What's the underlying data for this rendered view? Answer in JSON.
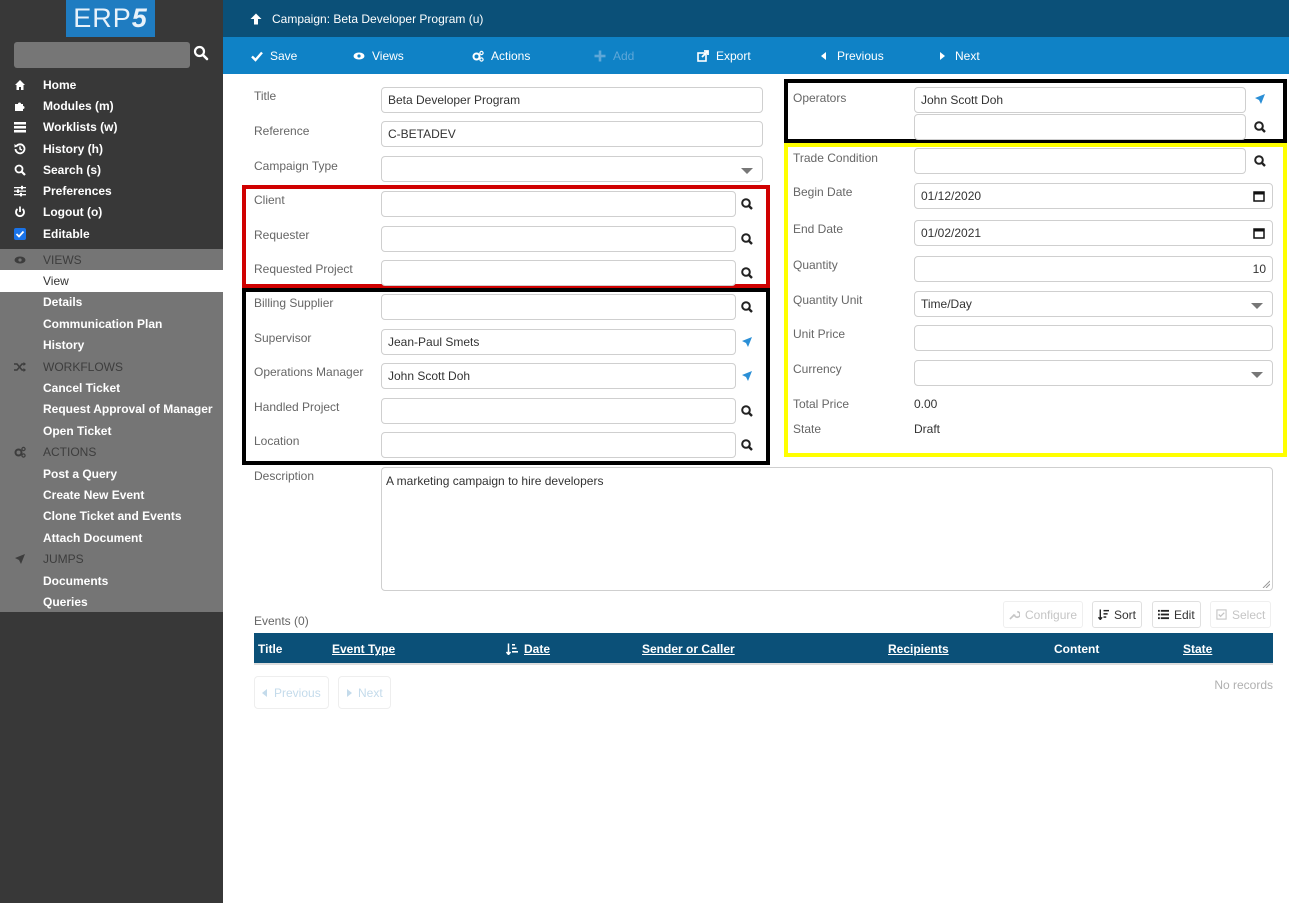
{
  "app": {
    "logo": "ERP",
    "logo_suffix": "5"
  },
  "sidebar": {
    "search_placeholder": "",
    "nav": [
      {
        "label": "Home",
        "icon": "home-icon"
      },
      {
        "label": "Modules (m)",
        "icon": "puzzle-icon"
      },
      {
        "label": "Worklists (w)",
        "icon": "tasks-icon"
      },
      {
        "label": "History (h)",
        "icon": "history-icon"
      },
      {
        "label": "Search (s)",
        "icon": "search-icon"
      },
      {
        "label": "Preferences",
        "icon": "sliders-icon"
      },
      {
        "label": "Logout (o)",
        "icon": "power-icon"
      },
      {
        "label": "Editable",
        "icon": "checkbox-icon"
      }
    ],
    "views_header": "VIEWS",
    "views": [
      "View",
      "Details",
      "Communication Plan",
      "History"
    ],
    "workflows_header": "WORKFLOWS",
    "workflows": [
      "Cancel Ticket",
      "Request Approval of Manager",
      "Open Ticket"
    ],
    "actions_header": "ACTIONS",
    "actions": [
      "Post a Query",
      "Create New Event",
      "Clone Ticket and Events",
      "Attach Document"
    ],
    "jumps_header": "JUMPS",
    "jumps": [
      "Documents",
      "Queries"
    ]
  },
  "header": {
    "title": "Campaign: Beta Developer Program (u)"
  },
  "toolbar": {
    "save": "Save",
    "views": "Views",
    "actions": "Actions",
    "add": "Add",
    "export": "Export",
    "previous": "Previous",
    "next": "Next"
  },
  "form": {
    "title": {
      "label": "Title",
      "value": "Beta Developer Program"
    },
    "reference": {
      "label": "Reference",
      "value": "C-BETADEV"
    },
    "campaign_type": {
      "label": "Campaign Type",
      "value": ""
    },
    "client": {
      "label": "Client",
      "value": ""
    },
    "requester": {
      "label": "Requester",
      "value": ""
    },
    "requested_project": {
      "label": "Requested Project",
      "value": ""
    },
    "billing_supplier": {
      "label": "Billing Supplier",
      "value": ""
    },
    "supervisor": {
      "label": "Supervisor",
      "value": "Jean-Paul Smets"
    },
    "operations_manager": {
      "label": "Operations Manager",
      "value": "John Scott Doh"
    },
    "handled_project": {
      "label": "Handled Project",
      "value": ""
    },
    "location": {
      "label": "Location",
      "value": ""
    },
    "operators": {
      "label": "Operators",
      "values": [
        "John Scott Doh",
        ""
      ]
    },
    "trade_condition": {
      "label": "Trade Condition",
      "value": ""
    },
    "begin_date": {
      "label": "Begin Date",
      "value": "01/12/2020"
    },
    "end_date": {
      "label": "End Date",
      "value": "01/02/2021"
    },
    "quantity": {
      "label": "Quantity",
      "value": "10"
    },
    "quantity_unit": {
      "label": "Quantity Unit",
      "value": "Time/Day"
    },
    "unit_price": {
      "label": "Unit Price",
      "value": ""
    },
    "currency": {
      "label": "Currency",
      "value": ""
    },
    "total_price": {
      "label": "Total Price",
      "value": "0.00"
    },
    "state": {
      "label": "State",
      "value": "Draft"
    },
    "description": {
      "label": "Description",
      "value": "A marketing campaign to hire developers"
    }
  },
  "highlight_colors": {
    "red": "#d00000",
    "black": "#000000",
    "yellow": "#ffff00"
  },
  "events": {
    "label": "Events (0)",
    "buttons": {
      "configure": "Configure",
      "sort": "Sort",
      "edit": "Edit",
      "select": "Select"
    },
    "columns": [
      "Title",
      "Event Type",
      "Date",
      "Sender or Caller",
      "Recipients",
      "Content",
      "State"
    ],
    "empty": "No records",
    "pager": {
      "previous": "Previous",
      "next": "Next"
    }
  }
}
